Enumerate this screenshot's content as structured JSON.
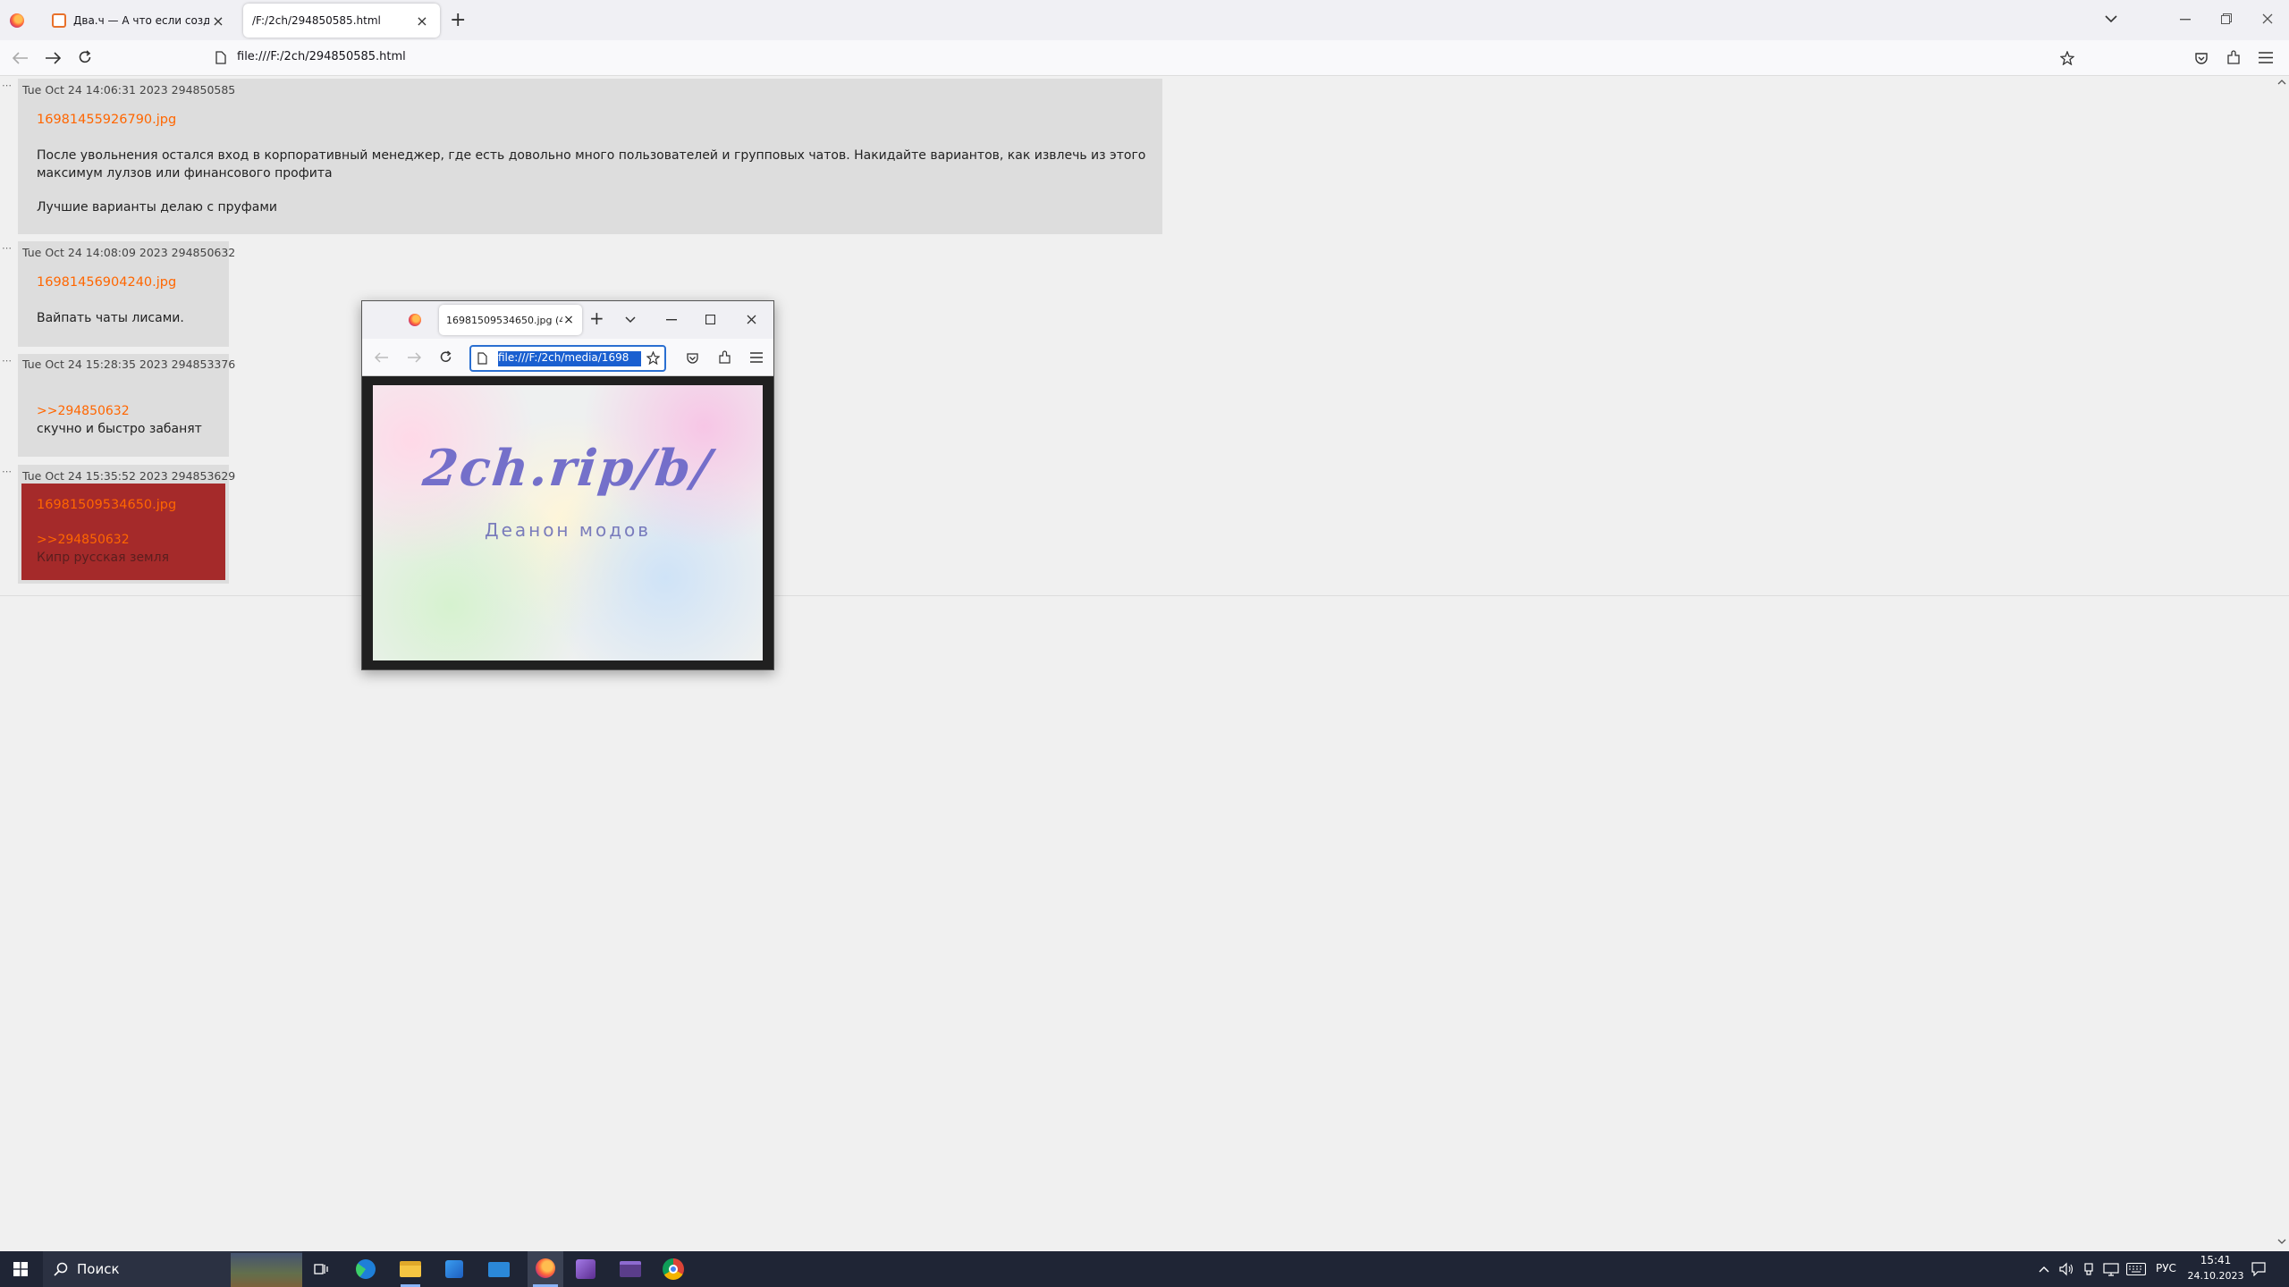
{
  "browser": {
    "tabs": [
      {
        "label": "Два.ч — А что если создать бо"
      },
      {
        "label": "/F:/2ch/294850585.html"
      }
    ],
    "url": "file:///F:/2ch/294850585.html",
    "new_tab_symbol": "+",
    "close_symbol": "×"
  },
  "posts": [
    {
      "header": "Tue Oct 24 14:06:31 2023 294850585",
      "file": "16981455926790.jpg",
      "lines": [
        "После увольнения остался вход в корпоративный менеджер, где есть довольно много пользователей и групповых чатов. Накидайте вариантов, как извлечь из этого",
        "максимум лулзов или финансового профита",
        "Лучшие варианты делаю с пруфами"
      ]
    },
    {
      "header": "Tue Oct 24 14:08:09 2023 294850632",
      "file": "16981456904240.jpg",
      "lines": [
        "Вайпать чаты лисами."
      ]
    },
    {
      "header": "Tue Oct 24 15:28:35 2023 294853376",
      "reply": ">>294850632",
      "lines": [
        "скучно и быстро забанят"
      ]
    },
    {
      "header": "Tue Oct 24 15:35:52 2023 294853629",
      "file": "16981509534650.jpg",
      "reply": ">>294850632",
      "lines": [
        "Кипр русская земля"
      ]
    }
  ],
  "post_dots": "⋯",
  "popup": {
    "tab_label": "16981509534650.jpg (4",
    "url": "file:///F:/2ch/media/1698",
    "image_text_main": "2ch.rip/b/",
    "image_text_sub": "Деанон модов"
  },
  "taskbar": {
    "search_placeholder": "Поиск",
    "language": "РУС",
    "time": "15:41",
    "date": "24.10.2023"
  },
  "colors": {
    "accent_link": "#ff6600",
    "highlight_post": "#a52a2a",
    "post_bg": "#dddddd"
  }
}
